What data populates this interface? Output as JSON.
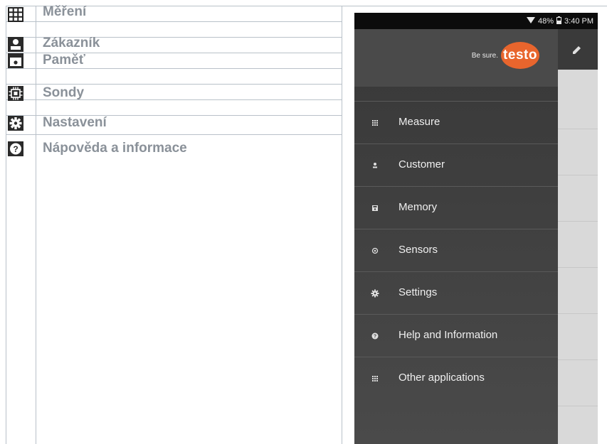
{
  "legend": [
    {
      "label": "Měření",
      "icon": "grid-icon"
    },
    {
      "label": "Zákazník",
      "icon": "person-icon"
    },
    {
      "label": "Paměť",
      "icon": "memory-icon"
    },
    {
      "label": "Sondy",
      "icon": "sensor-icon"
    },
    {
      "label": "Nastavení",
      "icon": "gear-icon"
    },
    {
      "label": "Nápověda a informace",
      "icon": "help-icon"
    }
  ],
  "phone": {
    "status": {
      "battery": "48%",
      "time": "3:40 PM"
    },
    "tagline": "Be sure.",
    "logo": "testo",
    "menu": [
      {
        "label": "Measure",
        "icon": "grid-icon"
      },
      {
        "label": "Customer",
        "icon": "person-icon"
      },
      {
        "label": "Memory",
        "icon": "memory-icon"
      },
      {
        "label": "Sensors",
        "icon": "sensor-icon"
      },
      {
        "label": "Settings",
        "icon": "gear-icon"
      },
      {
        "label": "Help and Information",
        "icon": "help-icon"
      },
      {
        "label": "Other applications",
        "icon": "grid-icon"
      }
    ]
  },
  "colors": {
    "accent": "#e8652d",
    "legend_text": "#8a9199",
    "drawer": "#3f3f3f"
  }
}
